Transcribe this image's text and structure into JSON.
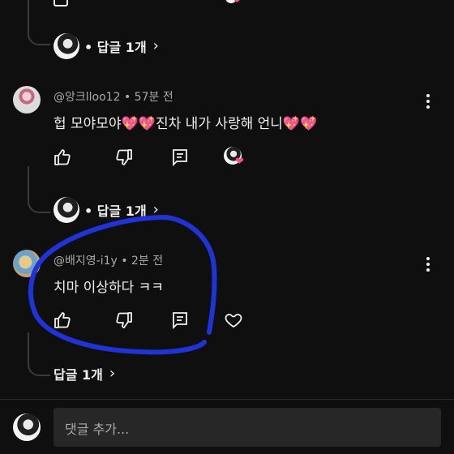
{
  "top_reply": {
    "label": "• 답글 1개"
  },
  "comments": [
    {
      "author": "@앙크lloo12",
      "time": "57분 전",
      "text": "헙 모야모야💖💖진차 내가 사랑해 언니💖💖",
      "reply_label": "• 답글 1개"
    },
    {
      "author": "@배지영-i1y",
      "time": "2분 전",
      "text": "치마 이상하다 ㅋㅋ",
      "reply_label": "답글 1개"
    }
  ],
  "composer": {
    "placeholder": "댓글 추가..."
  },
  "colors": {
    "background": "#0f0f0f",
    "text": "#f1f1f1",
    "meta": "#aaaaaa",
    "annotation": "#1f33d6"
  },
  "icons": [
    "like-icon",
    "dislike-icon",
    "reply-icon",
    "heart-icon",
    "chevron-right-icon",
    "more-icon"
  ]
}
